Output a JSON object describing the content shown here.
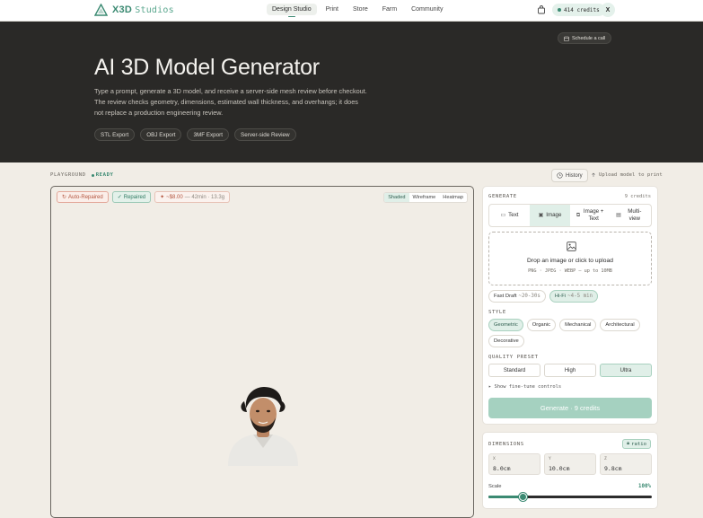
{
  "nav": {
    "brand": "X3D",
    "brand_suffix": "Studios",
    "links": [
      "Design Studio",
      "Print",
      "Store",
      "Farm",
      "Community"
    ],
    "active_link": "Design Studio",
    "credits": "414 credits",
    "avatar": "X"
  },
  "hero": {
    "schedule": "Schedule a call",
    "title": "AI 3D Model Generator",
    "description": "Type a prompt, generate a 3D model, and receive a server-side mesh review before checkout. The review checks geometry, dimensions, estimated wall thickness, and overhangs; it does not replace a production engineering review.",
    "chips": [
      "STL Export",
      "OBJ Export",
      "3MF Export",
      "Server-side Review"
    ]
  },
  "playground": {
    "label": "PLAYGROUND",
    "status": "READY",
    "history": "History",
    "upload": "Upload model to print",
    "badges": {
      "auto": "Auto-Repaired",
      "repaired": "Repaired",
      "cost": "~$8.00",
      "cost_meta": "— 42min · 13.3g"
    },
    "modes": [
      "Shaded",
      "Wireframe",
      "Heatmap"
    ],
    "active_mode": "Shaded"
  },
  "generate": {
    "header": "GENERATE",
    "cost": "9 credits",
    "tabs": [
      "Text",
      "Image",
      "Image + Text",
      "Multi-view"
    ],
    "active_tab": "Image",
    "drop_title": "Drop an image or click to upload",
    "drop_sub": "PNG · JPEG · WEBP — up to 10MB",
    "speed": [
      {
        "label": "Fast Draft",
        "sub": "~20-30s"
      },
      {
        "label": "Hi-Fi",
        "sub": "~4-5 min"
      }
    ],
    "active_speed": "Hi-Fi",
    "style_label": "STYLE",
    "styles": [
      "Geometric",
      "Organic",
      "Mechanical",
      "Architectural",
      "Decorative"
    ],
    "active_style": "Geometric",
    "quality_label": "QUALITY PRESET",
    "quality": [
      "Standard",
      "High",
      "Ultra"
    ],
    "active_quality": "Ultra",
    "finetune": "▸ Show fine-tune controls",
    "button": "Generate · 9 credits"
  },
  "dimensions": {
    "header": "DIMENSIONS",
    "ratio": "ratio",
    "x_label": "X",
    "x": "8.0cm",
    "y_label": "Y",
    "y": "10.0cm",
    "z_label": "Z",
    "z": "9.8cm",
    "scale_label": "Scale",
    "scale_value": "100%",
    "scale_fraction": 0.21
  },
  "colors": {
    "accent": "#3b8a72",
    "hero_bg": "#2a2927",
    "page_bg": "#f1ede6"
  }
}
